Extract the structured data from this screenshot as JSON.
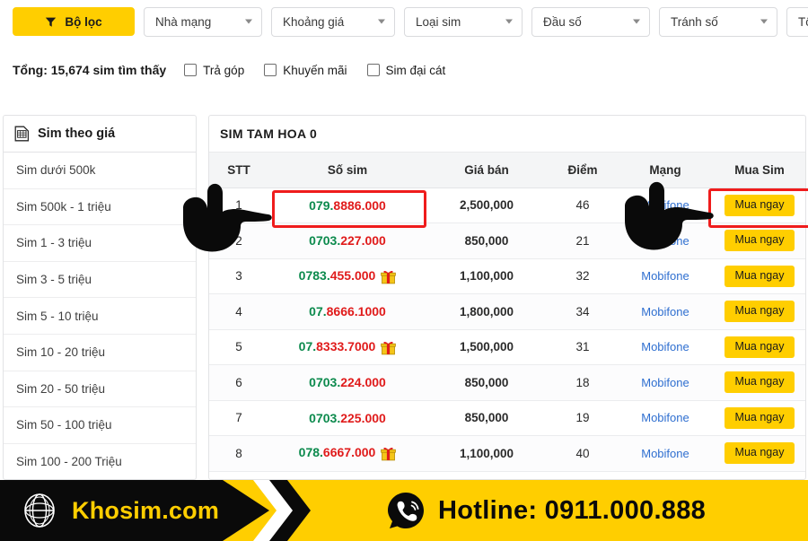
{
  "filter_bar": {
    "main_button": {
      "label": "Bộ lọc",
      "icon": "funnel-icon",
      "bg": "#FFCE00"
    },
    "dropdowns": [
      {
        "label": "Nhà mạng"
      },
      {
        "label": "Khoảng giá"
      },
      {
        "label": "Loại sim"
      },
      {
        "label": "Đầu số"
      },
      {
        "label": "Tránh số"
      },
      {
        "label": "Tổng điể"
      }
    ]
  },
  "totals": {
    "text": "Tổng: 15,674 sim tìm thấy",
    "count": "15,674",
    "checkboxes": [
      {
        "label": "Trả góp",
        "checked": false
      },
      {
        "label": "Khuyến mãi",
        "checked": false
      },
      {
        "label": "Sim đại cát",
        "checked": false
      }
    ]
  },
  "sidebar": {
    "header": {
      "label": "Sim theo giá",
      "icon": "sim-card-icon"
    },
    "items": [
      {
        "label": "Sim dưới 500k"
      },
      {
        "label": "Sim 500k - 1 triệu"
      },
      {
        "label": "Sim 1 - 3 triệu"
      },
      {
        "label": "Sim 3 - 5 triệu"
      },
      {
        "label": "Sim 5 - 10 triệu"
      },
      {
        "label": "Sim 10 - 20 triệu"
      },
      {
        "label": "Sim 20 - 50 triệu"
      },
      {
        "label": "Sim 50 - 100 triệu"
      },
      {
        "label": "Sim 100 - 200 Triệu"
      }
    ]
  },
  "content": {
    "title": "SIM TAM HOA 0",
    "columns": [
      "STT",
      "Số sim",
      "Giá bán",
      "Điểm",
      "Mạng",
      "Mua Sim"
    ],
    "buy_label": "Mua ngay",
    "rows": [
      {
        "stt": "1",
        "sim_prefix": "079.",
        "sim_suffix": "8886.000",
        "gift": false,
        "price": "2,500,000",
        "diem": "46",
        "mang": "Mobifone"
      },
      {
        "stt": "2",
        "sim_prefix": "0703.",
        "sim_suffix": "227.000",
        "gift": false,
        "price": "850,000",
        "diem": "21",
        "mang": "Mobifone"
      },
      {
        "stt": "3",
        "sim_prefix": "0783.",
        "sim_suffix": "455.000",
        "gift": true,
        "price": "1,100,000",
        "diem": "32",
        "mang": "Mobifone"
      },
      {
        "stt": "4",
        "sim_prefix": "07.",
        "sim_suffix": "8666.1000",
        "gift": false,
        "price": "1,800,000",
        "diem": "34",
        "mang": "Mobifone"
      },
      {
        "stt": "5",
        "sim_prefix": "07.",
        "sim_suffix": "8333.7000",
        "gift": true,
        "price": "1,500,000",
        "diem": "31",
        "mang": "Mobifone"
      },
      {
        "stt": "6",
        "sim_prefix": "0703.",
        "sim_suffix": "224.000",
        "gift": false,
        "price": "850,000",
        "diem": "18",
        "mang": "Mobifone"
      },
      {
        "stt": "7",
        "sim_prefix": "0703.",
        "sim_suffix": "225.000",
        "gift": false,
        "price": "850,000",
        "diem": "19",
        "mang": "Mobifone"
      },
      {
        "stt": "8",
        "sim_prefix": "078.",
        "sim_suffix": "6667.000",
        "gift": true,
        "price": "1,100,000",
        "diem": "40",
        "mang": "Mobifone"
      }
    ]
  },
  "annotations": {
    "highlight_color": "#EF1C1C",
    "cursors": [
      "pointing-hand-icon",
      "pointing-hand-icon"
    ]
  },
  "footer": {
    "brand": "Khosim.com",
    "brand_icon": "globe-icon",
    "hotline": "Hotline: 0911.000.888",
    "hotline_icon": "phone-icon",
    "bg": "#FFCE00"
  },
  "colors": {
    "accent_yellow": "#FFCE00",
    "sim_green": "#0C8A4D",
    "sim_red": "#E01B1B",
    "link_blue": "#2F6FD0",
    "highlight_red": "#EF1C1C"
  }
}
